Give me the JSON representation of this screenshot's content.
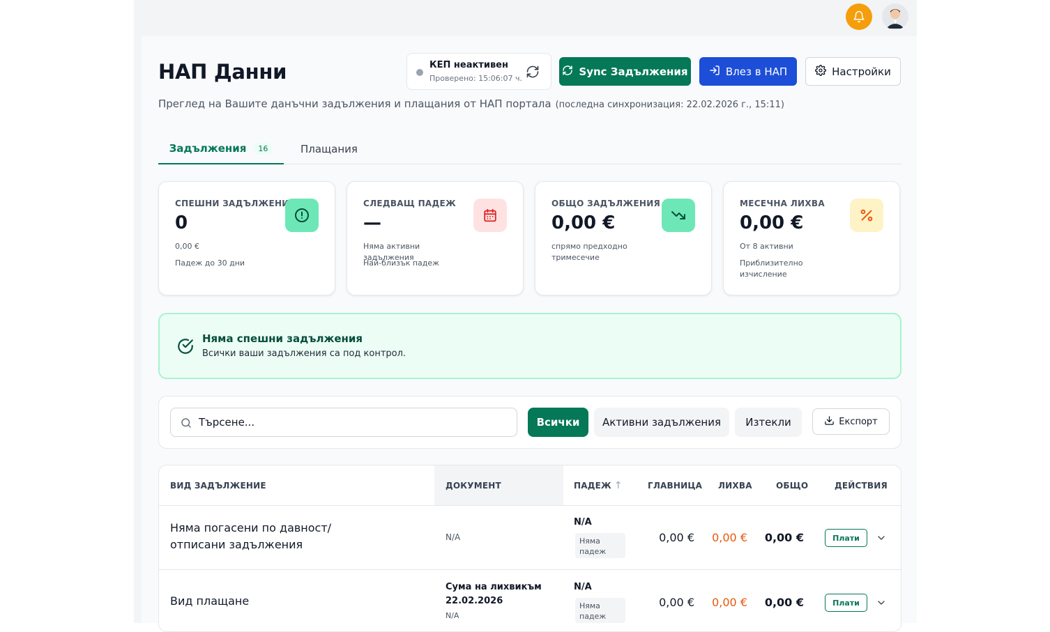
{
  "header": {
    "notifications_icon": "bell-icon",
    "avatar_icon": "user-avatar"
  },
  "page": {
    "title": "НАП Данни",
    "subtitle": "Преглед на Вашите данъчни задължения и плащания от НАП портала",
    "last_sync": "(последна синхронизация: 22.02.2026 г., 15:11)"
  },
  "kep": {
    "status": "КЕП неактивен",
    "checked": "Проверено: 15:06:07 ч."
  },
  "actions": {
    "sync_label": "Sync Задължения",
    "login_label": "Влез в НАП",
    "settings_label": "Настройки"
  },
  "tabs": [
    {
      "label": "Задължения",
      "count": "16"
    },
    {
      "label": "Плащания"
    }
  ],
  "cards": [
    {
      "label": "СПЕШНИ ЗАДЪЛЖЕНИЯ",
      "value": "0",
      "sub1": "0,00 €",
      "sub2": "Падеж до 30 дни",
      "icon": "alert-circle-icon",
      "color": "#6ee7b7"
    },
    {
      "label": "СЛЕДВАЩ ПАДЕЖ",
      "value": "—",
      "sub1": "Няма активни задължения",
      "sub2": "Най-близък падеж",
      "icon": "calendar-icon",
      "color": "#fee2e2"
    },
    {
      "label": "ОБЩО ЗАДЪЛЖЕНИЯ",
      "value": "0,00 €",
      "sub1": "спрямо предходно тримесечие",
      "sub2": "",
      "icon": "trending-down-icon",
      "color": "#6ee7b7"
    },
    {
      "label": "МЕСЕЧНА ЛИХВА",
      "value": "0,00 €",
      "sub1": "От 8 активни",
      "sub2": "Приблизително изчисление",
      "icon": "percent-icon",
      "color": "#fef3c7"
    }
  ],
  "alert": {
    "title": "Няма спешни задължения",
    "text": "Всички ваши задължения са под контрол."
  },
  "filters": {
    "search_placeholder": "Търсене...",
    "all": "Всички",
    "active": "Активни задължения",
    "expired": "Изтекли",
    "export": "Експорт"
  },
  "table": {
    "headers": {
      "kind": "ВИД ЗАДЪЛЖЕНИЕ",
      "document": "ДОКУМЕНТ",
      "due": "ПАДЕЖ",
      "due_sort": "↑",
      "principal": "ГЛАВНИЦА",
      "interest": "ЛИХВА",
      "total": "ОБЩО",
      "actions": "ДЕЙСТВИЯ"
    },
    "rows": [
      {
        "kind": "Няма погасени по давност/отписани задължения",
        "document": "N/A",
        "document_line2": "",
        "document_sub": "",
        "due": "N/A",
        "due_badge": "Няма падеж",
        "principal": "0,00 €",
        "interest": "0,00 €",
        "total": "0,00 €",
        "pay": "Плати"
      },
      {
        "kind": "Вид плащане",
        "document": "Сума на лихвикъм",
        "document_line2": "22.02.2026",
        "document_sub": "N/A",
        "due": "N/A",
        "due_badge": "Няма падеж",
        "principal": "0,00 €",
        "interest": "0,00 €",
        "total": "0,00 €",
        "pay": "Плати"
      }
    ]
  }
}
